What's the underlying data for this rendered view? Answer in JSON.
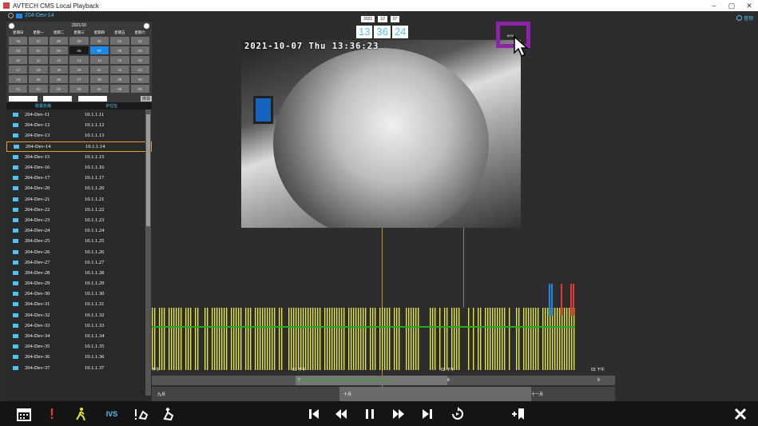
{
  "window": {
    "title": "AVTECH CMS Local Playback",
    "minimize": "–",
    "maximize": "▢",
    "close": "✕"
  },
  "top_right_label": "音频",
  "selected_device": "204-Dev-14",
  "calendar": {
    "month": "2021/10",
    "weekdays": [
      "星期日",
      "星期一",
      "星期二",
      "星期三",
      "星期四",
      "星期五",
      "星期六"
    ],
    "days": [
      "26",
      "27",
      "28",
      "29",
      "30",
      "01",
      "02",
      "03",
      "04",
      "05",
      "06",
      "07",
      "08",
      "09",
      "10",
      "11",
      "12",
      "13",
      "14",
      "15",
      "16",
      "17",
      "18",
      "19",
      "20",
      "21",
      "22",
      "23",
      "24",
      "25",
      "26",
      "27",
      "28",
      "29",
      "30",
      "31",
      "01",
      "02",
      "03",
      "04",
      "05",
      "06"
    ],
    "selected": "07",
    "dark": "06"
  },
  "time_filter": {
    "sep1": ":",
    "sep2": ":",
    "search_label": "搜尋"
  },
  "list_header": {
    "name": "裝置名稱",
    "ip": "IP位址"
  },
  "devices": [
    {
      "name": "204-Dev-11",
      "ip": "10.1.1.11"
    },
    {
      "name": "204-Dev-12",
      "ip": "10.1.1.12"
    },
    {
      "name": "204-Dev-13",
      "ip": "10.1.1.13"
    },
    {
      "name": "204-Dev-14",
      "ip": "10.1.1.14"
    },
    {
      "name": "204-Dev-15",
      "ip": "10.1.1.15"
    },
    {
      "name": "204-Dev-16",
      "ip": "10.1.1.16"
    },
    {
      "name": "204-Dev-17",
      "ip": "10.1.1.17"
    },
    {
      "name": "204-Dev-20",
      "ip": "10.1.1.20"
    },
    {
      "name": "204-Dev-21",
      "ip": "10.1.1.21"
    },
    {
      "name": "204-Dev-22",
      "ip": "10.1.1.22"
    },
    {
      "name": "204-Dev-23",
      "ip": "10.1.1.23"
    },
    {
      "name": "204-Dev-24",
      "ip": "10.1.1.24"
    },
    {
      "name": "204-Dev-25",
      "ip": "10.1.1.25"
    },
    {
      "name": "204-Dev-26",
      "ip": "10.1.1.26"
    },
    {
      "name": "204-Dev-27",
      "ip": "10.1.1.27"
    },
    {
      "name": "204-Dev-28",
      "ip": "10.1.1.28"
    },
    {
      "name": "204-Dev-29",
      "ip": "10.1.1.29"
    },
    {
      "name": "204-Dev-30",
      "ip": "10.1.1.30"
    },
    {
      "name": "204-Dev-31",
      "ip": "10.1.1.31"
    },
    {
      "name": "204-Dev-32",
      "ip": "10.1.1.32"
    },
    {
      "name": "204-Dev-33",
      "ip": "10.1.1.33"
    },
    {
      "name": "204-Dev-34",
      "ip": "10.1.1.34"
    },
    {
      "name": "204-Dev-35",
      "ip": "10.1.1.35"
    },
    {
      "name": "204-Dev-36",
      "ip": "10.1.1.36"
    },
    {
      "name": "204-Dev-37",
      "ip": "10.1.1.37"
    }
  ],
  "selected_device_index": 3,
  "date_selector": {
    "year": "2021",
    "month": "10",
    "day": "07"
  },
  "clock": {
    "hour": "13",
    "minute": "36",
    "second": "24"
  },
  "video": {
    "osd": "2021-10-07 Thu 13:36:23",
    "zoom_tag": "60%"
  },
  "timeline": {
    "hour_labels": [
      "下午",
      "01 下午",
      "02 下午",
      "03 下午"
    ],
    "minute_labels": [
      "7",
      "8",
      "9"
    ],
    "month_labels": [
      "九月",
      "十月",
      "十一月"
    ]
  },
  "toolbar": {
    "ivs_label": "IVS"
  },
  "colors": {
    "accent": "#4fc3f7",
    "highlight": "#8e24aa",
    "record": "#e6e62e",
    "motion": "#1eae1e"
  }
}
